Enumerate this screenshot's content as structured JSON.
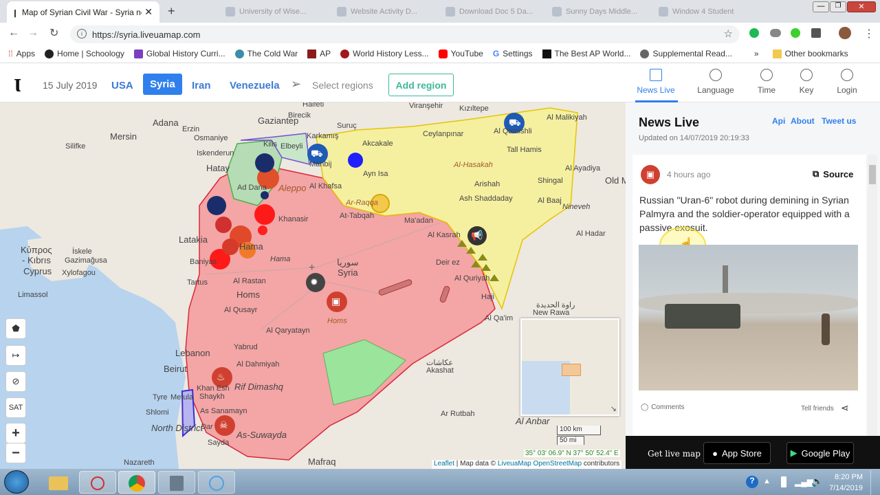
{
  "browser": {
    "active_tab_title": "Map of Syrian Civil War - Syria ne",
    "ghost_tabs": [
      "University of Wise...",
      "Website Activity D...",
      "Download Doc 5 Da...",
      "Sunny Days Middle...",
      "Window 4 Student"
    ],
    "url": "https://syria.liveuamap.com",
    "bookmarks": [
      "Apps",
      "Home | Schoology",
      "Global History Curri...",
      "The Cold War",
      "AP",
      "World History Less...",
      "YouTube",
      "Settings",
      "The Best AP World...",
      "Supplemental Read..."
    ],
    "bookmarks_overflow": "»",
    "other_bookmarks": "Other bookmarks",
    "colors": {
      "youtube": "#ff0000",
      "chrome_gray": "#dee1e6"
    }
  },
  "app": {
    "date": "15 July 2019",
    "regions": [
      "USA",
      "Syria",
      "Iran",
      "Venezuela"
    ],
    "active_region": "Syria",
    "select_regions": "Select regions",
    "add_region": "Add region",
    "nav": [
      {
        "label": "News Live",
        "icon": "news-icon"
      },
      {
        "label": "Language",
        "icon": "globe-icon"
      },
      {
        "label": "Time",
        "icon": "clock-icon"
      },
      {
        "label": "Key",
        "icon": "compass-icon"
      },
      {
        "label": "Login",
        "icon": "power-icon"
      }
    ],
    "accent": "#2f80ed",
    "add_region_color": "#3cb89a"
  },
  "map": {
    "labels": {
      "halfeti": "Halfeti",
      "birecik": "Birecik",
      "suruc": "Suruç",
      "viransehir": "Viranşehir",
      "kiziltepe": "Kızıltepe",
      "adana": "Adana",
      "gaziantep": "Gaziantep",
      "ceylanpinar": "Ceylanpınar",
      "alqamishli": "Al Qamishli",
      "almalikiyah": "Al Malikiyah",
      "osmaniye": "Osmaniye",
      "kilis": "Kilis",
      "karkamis": "Karkamış",
      "akcakale": "Akcakale",
      "mersin": "Mersin",
      "iskenderun": "Iskenderun",
      "elbeyli": "Elbeyli",
      "manbij": "Manbij",
      "tallhamis": "Tall Hamis",
      "alhasakah": "Al-Hasakah",
      "ayyadiya": "Al Ayadiya",
      "hatay": "Hatay",
      "silifke": "Silifke",
      "erzin": "Erzin",
      "aynisa": "Ayn Isa",
      "ad_dana": "Ad Dana",
      "aleppo": "Aleppo",
      "al_khafsa": "Al Khafsa",
      "shingal": "Shingal",
      "oldm": "Old M",
      "arishah": "Arishah",
      "ash_shaddaday": "Ash Shaddaday",
      "al_baaj": "Al Baaj",
      "nineveh": "Nineveh",
      "ar_raqqa": "Ar-Raqqa",
      "at_tabqah": "At-Tabqah",
      "khanasir": "Khanasir",
      "latakia": "Latakia",
      "ma_adan": "Ma'adan",
      "al_kasrah": "Al Kasrah",
      "al_hadar": "Al Hadar",
      "kypros": "Κύπρος",
      "kibris": "- Kıbrıs",
      "cyprus": "Cyprus",
      "iskele": "İskele",
      "gazimagusa": "Gazimağusa",
      "xylofagou": "Xylofagou",
      "baniyas": "Baniyas",
      "hama_ar": "Hama",
      "hama": "Hama",
      "suriya_ar": "سوريا",
      "syria": "Syria",
      "deir_ez": "Deir ez",
      "al_quriyah": "Al Quriyah",
      "tartus": "Tartus",
      "al_rastan": "Al Rastan",
      "limassol": "Limassol",
      "homs": "Homs",
      "homs_italic": "Homs",
      "hajin": "Haji",
      "rawah_ar": "راوة الحديدة",
      "new_rawa": "New Rawa",
      "al_qusayr": "Al Qusayr",
      "al_qaim": "Al Qa'im",
      "al_qaryatayn": "Al Qaryatayn",
      "yabrud": "Yabrud",
      "lebanon": "Lebanon",
      "akashat": "Akashat",
      "akashat_ar": "عكاشات",
      "al_dahmiyah": "Al Dahmiyah",
      "beirut": "Beirut",
      "rif_dimashq": "Rif Dimashq",
      "khan_esh": "Khan Esh",
      "shaykh": "Shaykh",
      "tyre": "Tyre",
      "metula": "Metula",
      "as_sanamayn": "As Sanamayn",
      "shlomi": "Shlomi",
      "north_district": "North District",
      "dara": "Dar",
      "as_suwayda": "As-Suwayda",
      "ar_rutbah": "Ar Rutbah",
      "al_anbar": "Al Anbar",
      "sayda": "Sayda",
      "mafraq": "Mafraq",
      "nazareth": "Nazareth"
    },
    "scale": {
      "km": "100 km",
      "mi": "50 mi"
    },
    "coordinates": "35° 03' 06.9\" N 37° 50' 52.4\" E",
    "attribution": {
      "leaflet": "Leaflet",
      "sep": " | Map data © ",
      "liveuamap": "LiveuaMap",
      "osm": "OpenStreetMap",
      "contributors": " contributors"
    },
    "controls": [
      {
        "name": "pentagon-control",
        "glyph": "⬟"
      },
      {
        "name": "measure-control",
        "glyph": "↦"
      },
      {
        "name": "hide-control",
        "glyph": "⊘"
      },
      {
        "name": "satellite-control",
        "glyph": "SAT"
      },
      {
        "name": "zoom-in-button",
        "glyph": "+"
      },
      {
        "name": "zoom-out-button",
        "glyph": "−"
      }
    ],
    "colors": {
      "sea": "#b7d3ee",
      "land": "#ede8e0",
      "government": "#f4a5a5",
      "sdf": "#f5f0a0",
      "rebel": "#b5dcb5",
      "us_zone": "#9be49b",
      "border": "#d8283a"
    }
  },
  "news": {
    "title": "News Live",
    "links": [
      "Api",
      "About",
      "Tweet us"
    ],
    "updated": "Updated on 14/07/2019 20:19:33",
    "time_ago": "4 hours ago",
    "source": "Source",
    "headline": "Russian \"Uran-6\" robot during demining in Syrian Palmyra and the soldier-operator equipped with a passive exosuit.",
    "comments": "Comments",
    "tell_friends": "Tell friends",
    "footer": {
      "get_app": "Get live map",
      "app_store": "App Store",
      "google_play": "Google Play"
    }
  },
  "taskbar": {
    "time": "8:20 PM",
    "date": "7/14/2019"
  }
}
